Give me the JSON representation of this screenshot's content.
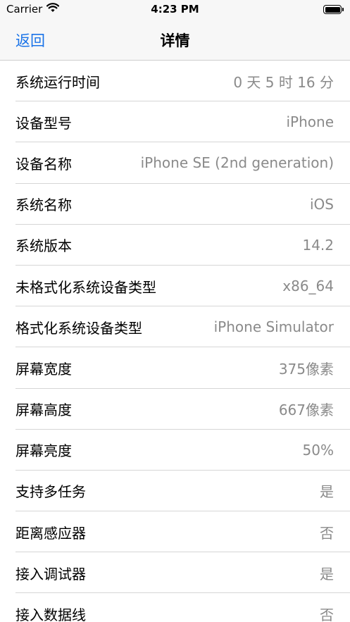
{
  "status_bar": {
    "carrier": "Carrier",
    "time": "4:23 PM",
    "wifi_icon": "wifi-icon",
    "battery_icon": "battery-full-icon"
  },
  "nav": {
    "back_label": "返回",
    "title": "详情"
  },
  "rows": [
    {
      "label": "系统运行时间",
      "value": "0 天 5 时 16 分"
    },
    {
      "label": "设备型号",
      "value": "iPhone"
    },
    {
      "label": "设备名称",
      "value": "iPhone SE (2nd generation)"
    },
    {
      "label": "系统名称",
      "value": "iOS"
    },
    {
      "label": "系统版本",
      "value": "14.2"
    },
    {
      "label": "未格式化系统设备类型",
      "value": "x86_64"
    },
    {
      "label": "格式化系统设备类型",
      "value": "iPhone Simulator"
    },
    {
      "label": "屏幕宽度",
      "value": "375像素"
    },
    {
      "label": "屏幕高度",
      "value": "667像素"
    },
    {
      "label": "屏幕亮度",
      "value": "50%"
    },
    {
      "label": "支持多任务",
      "value": "是"
    },
    {
      "label": "距离感应器",
      "value": "否"
    },
    {
      "label": "接入调试器",
      "value": "是"
    },
    {
      "label": "接入数据线",
      "value": "否"
    }
  ],
  "colors": {
    "accent": "#1a73e8",
    "secondary_text": "#8a8a8a",
    "bar_background": "#f7f7f7"
  }
}
